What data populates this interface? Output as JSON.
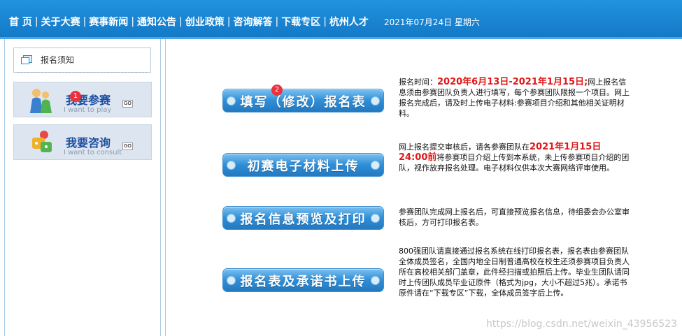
{
  "nav": {
    "items": [
      "首 页",
      "关于大赛",
      "赛事新闻",
      "通知公告",
      "创业政策",
      "咨询解答",
      "下载专区",
      "杭州人才"
    ],
    "separator": "|",
    "date": "2021年07月24日 星期六"
  },
  "sidebar": {
    "notice": "报名须知",
    "links": [
      {
        "main": "我要参赛",
        "sub": "I want to play",
        "go": "GO",
        "badge": "1"
      },
      {
        "main": "我要咨询",
        "sub": "I want to consult",
        "go": "GO"
      }
    ]
  },
  "main": {
    "buttons": [
      {
        "label": "填写（修改）报名表",
        "badge": "2"
      },
      {
        "label": "初赛电子材料上传"
      },
      {
        "label": "报名信息预览及打印"
      },
      {
        "label": "报名表及承诺书上传"
      }
    ],
    "desc1": {
      "prefix": "报名时间：",
      "highlight": "2020年6月13日-2021年1月15日;",
      "rest": "网上报名信息须由参赛团队负责人进行填写，每个参赛团队限报一个项目。网上报名完成后，请及时上传电子材料:参赛项目介绍和其他相关证明材料。"
    },
    "desc2": {
      "prefix": "网上报名提交审核后，请各参赛团队在",
      "highlight": "2021年1月15日24:00前",
      "rest": "将参赛项目介绍上传到本系统，未上传参赛项目介绍的团队，视作放弃报名处理。电子材料仅供本次大赛网络评审使用。"
    },
    "desc3": "参赛团队完成网上报名后，可直接预览报名信息，待组委会办公室审核后，方可打印报名表。",
    "desc4": "800强团队请直接通过报名系统在线打印报名表，报名表由参赛团队全体成员签名，全国内地全日制普通高校在校生还须参赛项目负责人所在高校相关部门盖章，此件经扫描或拍照后上传。毕业生团队请同时上传团队成员毕业证原件（格式为jpg，大小不超过5兆）。承诺书原件请在“下载专区”下载，全体成员签字后上传。"
  },
  "watermark": "https://blog.csdn.net/weixin_43956523"
}
